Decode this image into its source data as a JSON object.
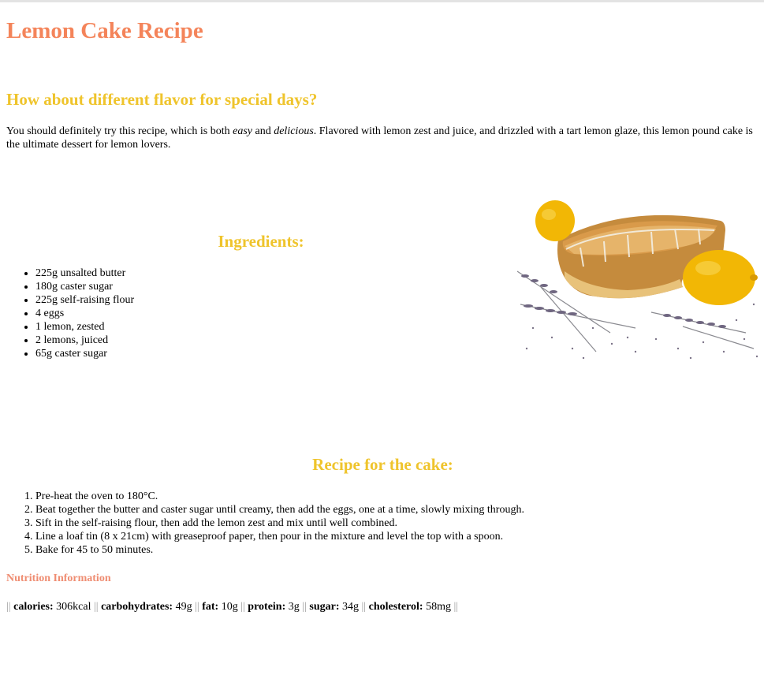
{
  "title": "Lemon Cake Recipe",
  "subtitle": "How about different flavor for special days?",
  "intro": {
    "part1": "You should definitely try this recipe, which is both ",
    "easy": "easy",
    "and": " and ",
    "delicious": "delicious",
    "part2": ". Flavored with lemon zest and juice, and drizzled with a tart lemon glaze, this lemon pound cake is the ultimate dessert for lemon lovers."
  },
  "ingredients": {
    "heading": "Ingredients:",
    "items": [
      "225g unsalted butter",
      "180g caster sugar",
      "225g self-raising flour",
      "4 eggs",
      "1 lemon, zested",
      "2 lemons, juiced",
      "65g caster sugar"
    ]
  },
  "recipe": {
    "heading": "Recipe for the cake:",
    "steps": [
      "Pre-heat the oven to 180°C.",
      "Beat together the butter and caster sugar until creamy, then add the eggs, one at a time, slowly mixing through.",
      "Sift in the self-raising flour, then add the lemon zest and mix until well combined.",
      "Line a loaf tin (8 x 21cm) with greaseproof paper, then pour in the mixture and level the top with a spoon.",
      "Bake for 45 to 50 minutes."
    ]
  },
  "nutrition": {
    "heading": "Nutrition Information",
    "separator": "||",
    "items": [
      {
        "label": "calories:",
        "value": "306kcal"
      },
      {
        "label": "carbohydrates:",
        "value": "49g"
      },
      {
        "label": "fat:",
        "value": "10g"
      },
      {
        "label": "protein:",
        "value": "3g"
      },
      {
        "label": "sugar:",
        "value": "34g"
      },
      {
        "label": "cholesterol:",
        "value": "58mg"
      }
    ]
  },
  "colors": {
    "title": "#f4845a",
    "headings": "#efc42c",
    "nutrition_heading": "#ef8d72"
  }
}
